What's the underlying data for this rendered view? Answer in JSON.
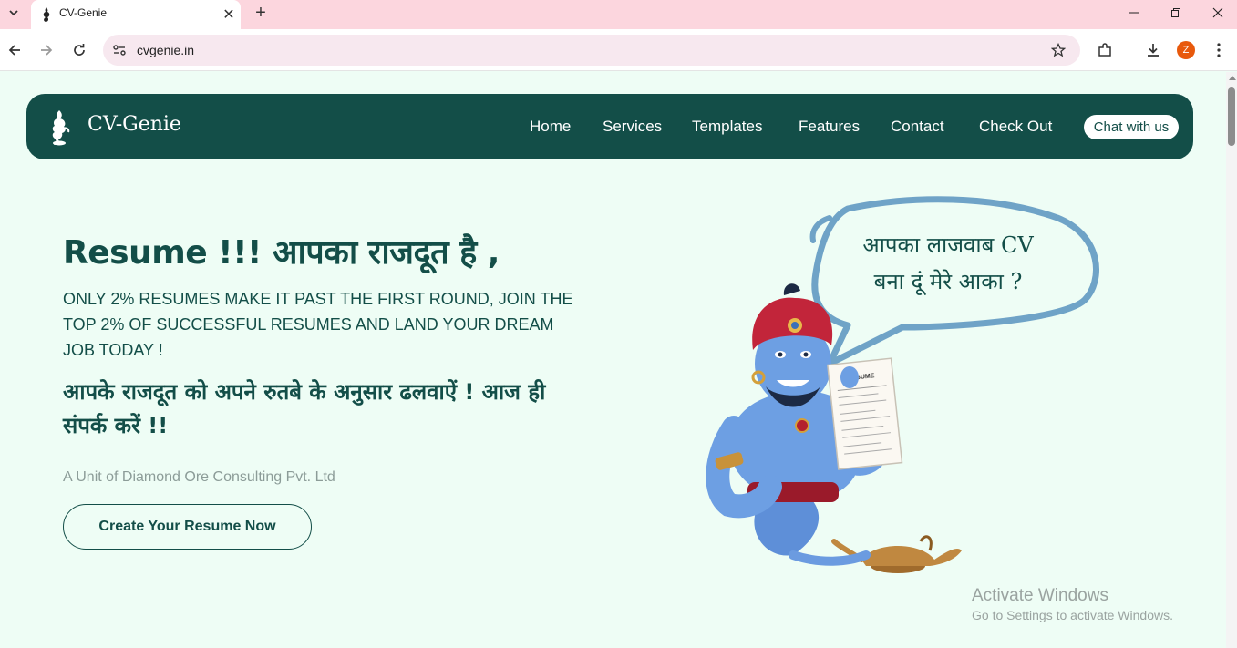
{
  "browser": {
    "tab_title": "CV-Genie",
    "url": "cvgenie.in",
    "profile_initial": "Z"
  },
  "site": {
    "brand": "CV-Genie",
    "nav": [
      "Home",
      "Services",
      "Templates",
      "Features",
      "Contact",
      "Check Out"
    ],
    "chat_button": "Chat with us"
  },
  "hero": {
    "title": "Resume !!! आपका राजदूत है ,",
    "subtitle": "ONLY 2% RESUMES MAKE IT PAST THE FIRST ROUND, JOIN THE TOP 2% OF SUCCESSFUL RESUMES AND LAND YOUR DREAM JOB TODAY !",
    "hindi_line": "आपके राजदूत को अपने रुतबे के अनुसार ढलवाऐं ! आज ही संपर्क करें !!",
    "unit": "A Unit of Diamond Ore Consulting Pvt. Ltd",
    "cta": "Create Your Resume Now"
  },
  "speech_bubble": {
    "line1": "आपका लाजवाब CV",
    "line2": "बना दूं मेरे आका ?"
  },
  "resume_paper": {
    "heading": "RESUME"
  },
  "watermark": {
    "title": "Activate Windows",
    "subtitle": "Go to Settings to activate Windows."
  },
  "colors": {
    "primary": "#134e48",
    "page_bg": "#eefdf5",
    "tabbar_bg": "#fcd6de",
    "bubble_stroke": "#6fa3c7"
  }
}
